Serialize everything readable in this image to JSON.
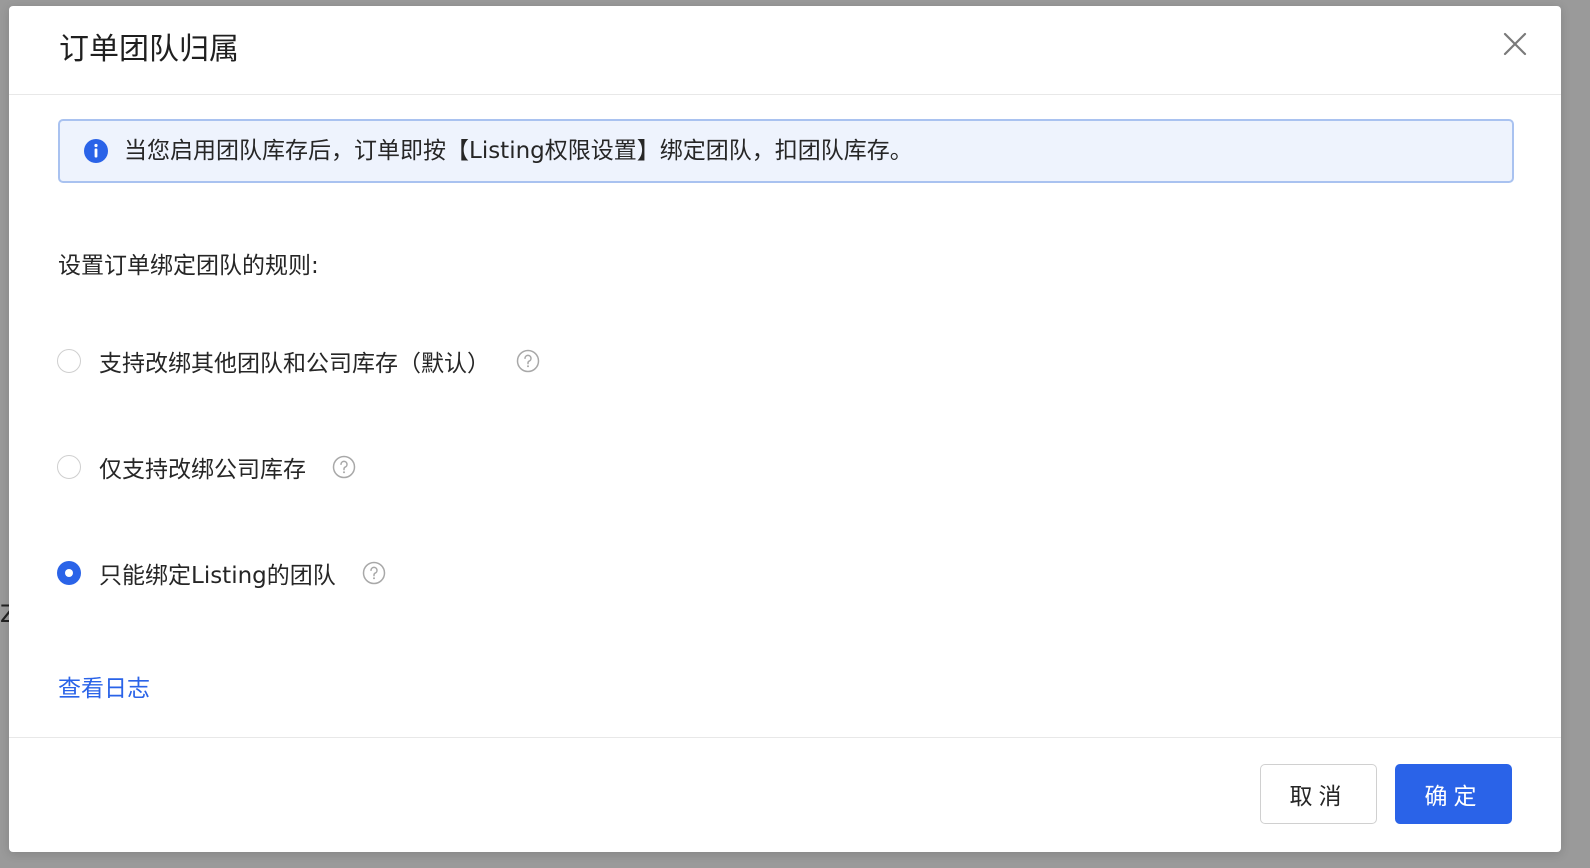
{
  "dialog": {
    "title": "订单团队归属"
  },
  "alert": {
    "text": "当您启用团队库存后，订单即按【Listing权限设置】绑定团队，扣团队库存。"
  },
  "rules": {
    "label": "设置订单绑定团队的规则:",
    "options": [
      {
        "label": "支持改绑其他团队和公司库存（默认）",
        "checked": false
      },
      {
        "label": "仅支持改绑公司库存",
        "checked": false
      },
      {
        "label": "只能绑定Listing的团队",
        "checked": true
      }
    ]
  },
  "links": {
    "view_log": "查看日志"
  },
  "footer": {
    "cancel_label": "取消",
    "ok_label": "确定"
  },
  "colors": {
    "primary": "#2a63e8",
    "alert_bg": "#eef3fd",
    "alert_border": "#a9c2f0"
  },
  "background": {
    "glyph": "Z"
  }
}
